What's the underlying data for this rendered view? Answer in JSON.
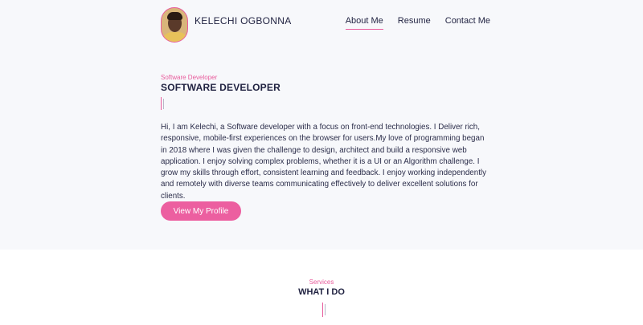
{
  "header": {
    "brand": "KELECHI OGBONNA",
    "nav": [
      {
        "label": "About Me",
        "active": true
      },
      {
        "label": "Resume",
        "active": false
      },
      {
        "label": "Contact Me",
        "active": false
      }
    ]
  },
  "hero": {
    "subtitle": "Software Developer",
    "title": "SOFTWARE DEVELOPER",
    "bio": "Hi, I am Kelechi, a Software developer with a focus on front-end technologies. I Deliver rich, responsive, mobile-first experiences on the browser for users.My love of programming began in 2018 where I was given the challenge to design, architect and build a responsive web application. I enjoy solving complex problems, whether it is a UI or an Algorithm challenge. I grow my skills through effort, consistent learning and feedback. I enjoy working independently and remotely with diverse teams communicating effectively to deliver excellent solutions for clients.",
    "cta_label": "View My Profile"
  },
  "services": {
    "label": "Services",
    "title": "WHAT I DO"
  },
  "colors": {
    "accent": "#e85c9c",
    "hero_background": "#f7f8fb",
    "text": "#1f2140"
  }
}
